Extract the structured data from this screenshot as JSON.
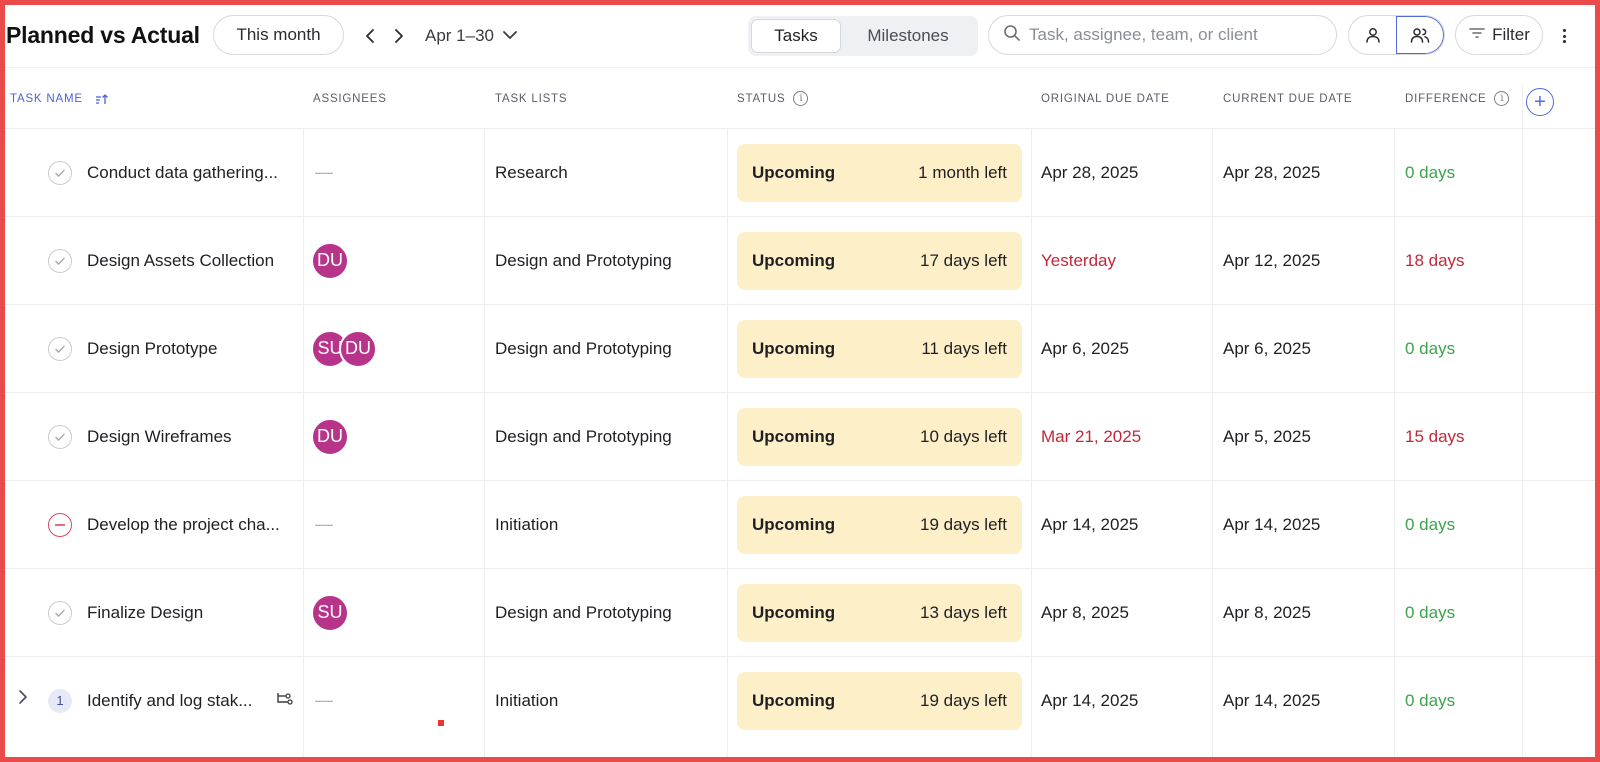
{
  "header": {
    "title": "Planned vs Actual",
    "period_button": "This month",
    "date_range": "Apr 1–30",
    "view_tabs": [
      {
        "label": "Tasks",
        "active": true
      },
      {
        "label": "Milestones",
        "active": false
      }
    ],
    "search": {
      "placeholder": "Task, assignee, team, or client",
      "value": ""
    },
    "filter_label": "Filter",
    "icons": {
      "prev": "chevron-left-icon",
      "next": "chevron-right-icon",
      "range_dropdown": "chevron-down-icon",
      "search": "search-icon",
      "single_user": "user-icon",
      "group": "users-icon",
      "filter": "filter-icon",
      "more": "more-vertical-icon"
    }
  },
  "table": {
    "columns": [
      {
        "label": "TASK NAME",
        "sorted": true
      },
      {
        "label": "ASSIGNEES"
      },
      {
        "label": "TASK LISTS"
      },
      {
        "label": "STATUS",
        "info": true
      },
      {
        "label": "ORIGINAL DUE DATE"
      },
      {
        "label": "CURRENT DUE DATE"
      },
      {
        "label": "DIFFERENCE",
        "info": true
      }
    ],
    "rows": [
      {
        "name": "Conduct data gathering...",
        "state": "check",
        "assignees": [],
        "list": "Research",
        "status": "Upcoming",
        "time_left": "1 month left",
        "original_due": "Apr 28, 2025",
        "original_late": false,
        "current_due": "Apr 28, 2025",
        "difference": "0 days",
        "diff_tone": "green"
      },
      {
        "name": "Design Assets Collection",
        "state": "check",
        "assignees": [
          "DU"
        ],
        "list": "Design and Prototyping",
        "status": "Upcoming",
        "time_left": "17 days left",
        "original_due": "Yesterday",
        "original_late": true,
        "current_due": "Apr 12, 2025",
        "difference": "18 days",
        "diff_tone": "red"
      },
      {
        "name": "Design Prototype",
        "state": "check",
        "assignees": [
          "SU",
          "DU"
        ],
        "list": "Design and Prototyping",
        "status": "Upcoming",
        "time_left": "11 days left",
        "original_due": "Apr 6, 2025",
        "original_late": false,
        "current_due": "Apr 6, 2025",
        "difference": "0 days",
        "diff_tone": "green"
      },
      {
        "name": "Design Wireframes",
        "state": "check",
        "assignees": [
          "DU"
        ],
        "list": "Design and Prototyping",
        "status": "Upcoming",
        "time_left": "10 days left",
        "original_due": "Mar 21, 2025",
        "original_late": true,
        "current_due": "Apr 5, 2025",
        "difference": "15 days",
        "diff_tone": "red"
      },
      {
        "name": "Develop the project cha...",
        "state": "blocked",
        "assignees": [],
        "list": "Initiation",
        "status": "Upcoming",
        "time_left": "19 days left",
        "original_due": "Apr 14, 2025",
        "original_late": false,
        "current_due": "Apr 14, 2025",
        "difference": "0 days",
        "diff_tone": "green"
      },
      {
        "name": "Finalize Design",
        "state": "check",
        "assignees": [
          "SU"
        ],
        "list": "Design and Prototyping",
        "status": "Upcoming",
        "time_left": "13 days left",
        "original_due": "Apr 8, 2025",
        "original_late": false,
        "current_due": "Apr 8, 2025",
        "difference": "0 days",
        "diff_tone": "green"
      },
      {
        "name": "Identify and log stak...",
        "state": "subtasks",
        "subtask_count": "1",
        "assignees": [],
        "list": "Initiation",
        "status": "Upcoming",
        "time_left": "19 days left",
        "original_due": "Apr 14, 2025",
        "original_late": false,
        "current_due": "Apr 14, 2025",
        "difference": "0 days",
        "diff_tone": "green"
      }
    ],
    "empty_assignee": "—"
  },
  "colors": {
    "accent": "#4f6bd8",
    "status_bg": "#fdefc8",
    "avatar": "#b8348a",
    "late": "#c0283a",
    "ok": "#3aa44a",
    "frame": "#ea4a4a"
  }
}
